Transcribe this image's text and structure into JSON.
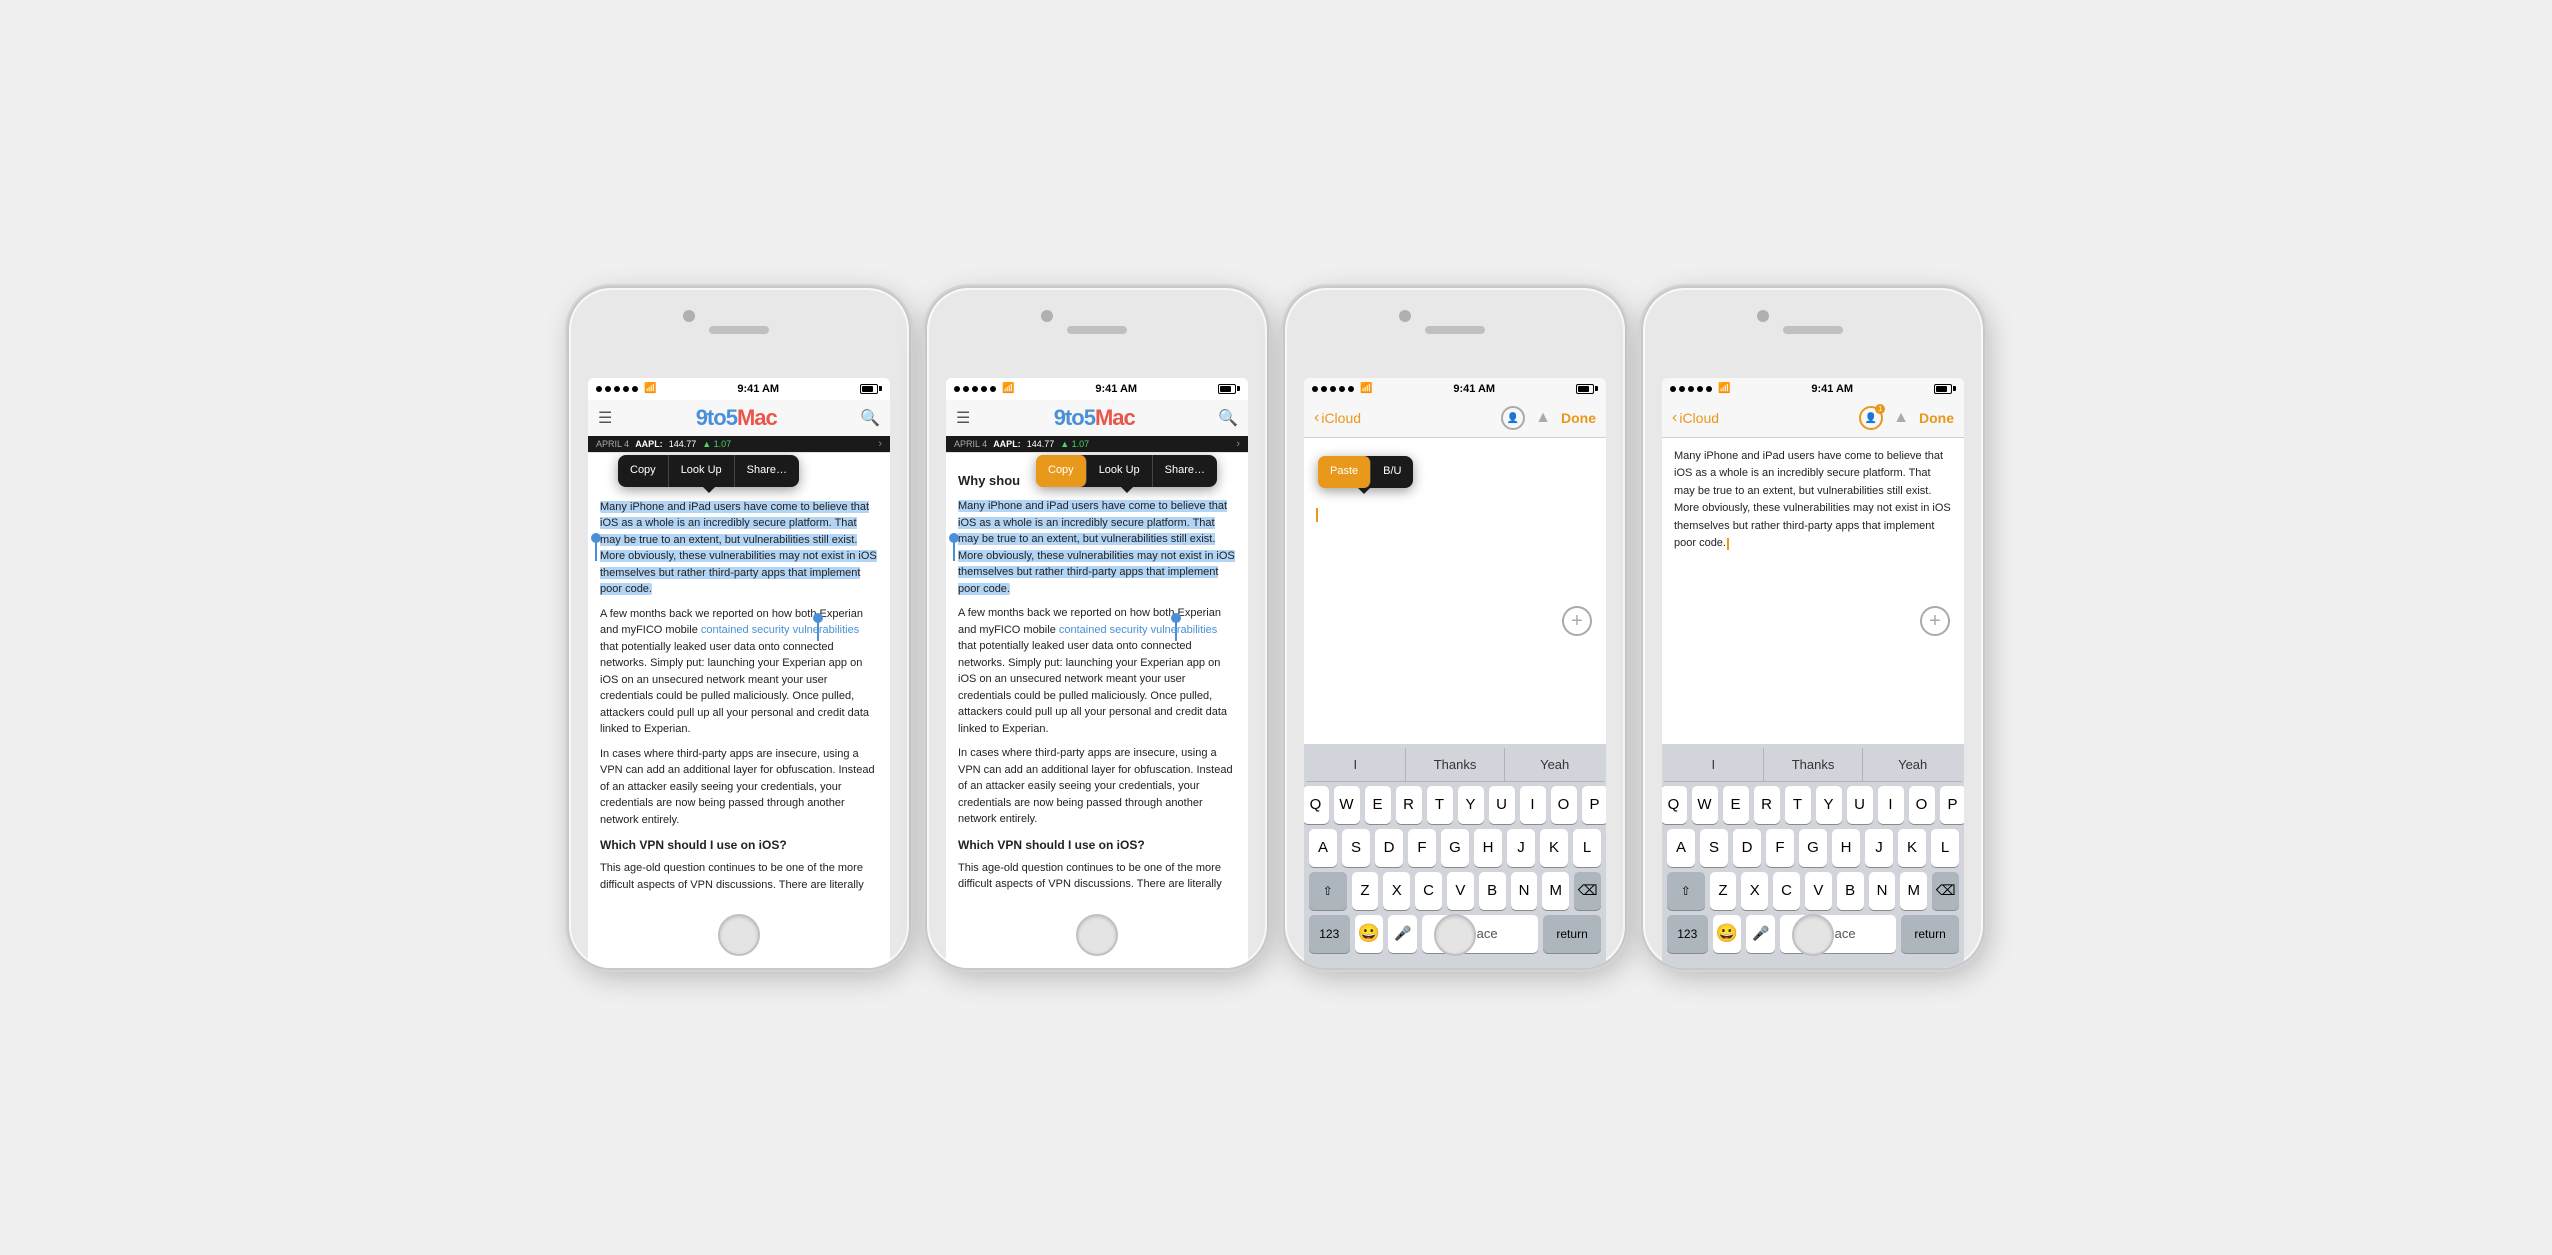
{
  "phones": [
    {
      "id": "phone1",
      "type": "safari",
      "status": {
        "dots": 5,
        "wifi": true,
        "time": "9:41 AM",
        "battery": "full"
      },
      "safari": {
        "url": "9to5mac.com",
        "logo": "9to5Mac",
        "ticker": {
          "date": "APRIL 4",
          "symbol": "AAPL:",
          "price": "144.77",
          "change": "1.07",
          "direction": "▲"
        }
      },
      "context_menu": {
        "buttons": [
          "Copy",
          "Look Up",
          "Share…"
        ],
        "highlighted": null,
        "position": "top"
      },
      "article": {
        "heading": null,
        "paragraphs": [
          "Many iPhone and iPad users have come to believe that iOS as a whole is an incredibly secure platform. That may be true to an extent, but vulnerabilities still exist. More obviously, these vulnerabilities may not exist in iOS themselves but rather third-party apps that implement poor code.",
          "A few months back we reported on how both Experian and myFICO mobile contained security vulnerabilities that potentially leaked user data onto connected networks. Simply put: launching your Experian app on iOS on an unsecured network meant your user credentials could be pulled maliciously. Once pulled, attackers could pull up all your personal and credit data linked to Experian.",
          "In cases where third-party apps are insecure, using a VPN can add an additional layer for obfuscation. Instead of an attacker easily seeing your credentials, your credentials are now being passed through another network entirely.",
          "Which VPN should I use on iOS?",
          "This age-old question continues to be one of the more difficult aspects of VPN discussions. There are literally"
        ],
        "link_text": "contained security vulnerabilities"
      },
      "selection": {
        "start_para": 0,
        "highlight": true
      }
    },
    {
      "id": "phone2",
      "type": "safari",
      "status": {
        "dots": 5,
        "wifi": true,
        "time": "9:41 AM",
        "battery": "full"
      },
      "safari": {
        "url": "9to5mac.com",
        "logo": "9to5Mac",
        "ticker": {
          "date": "APRIL 4",
          "symbol": "AAPL:",
          "price": "144.77",
          "change": "1.07",
          "direction": "▲"
        }
      },
      "context_menu": {
        "buttons": [
          "Copy",
          "Look Up",
          "Share…"
        ],
        "highlighted": "Copy",
        "position": "mid"
      },
      "article": {
        "heading": "Why shou",
        "paragraphs": [
          "Many iPhone and iPad users have come to believe that iOS as a whole is an incredibly secure platform. That may be true to an extent, but vulnerabilities still exist. More obviously, these vulnerabilities may not exist in iOS themselves but rather third-party apps that implement poor code.",
          "A few months back we reported on how both Experian and myFICO mobile contained security vulnerabilities that potentially leaked user data onto connected networks. Simply put: launching your Experian app on iOS on an unsecured network meant your user credentials could be pulled maliciously. Once pulled, attackers could pull up all your personal and credit data linked to Experian.",
          "In cases where third-party apps are insecure, using a VPN can add an additional layer for obfuscation. Instead of an attacker easily seeing your credentials, your credentials are now being passed through another network entirely.",
          "Which VPN should I use on iOS?",
          "This age-old question continues to be one of the more difficult aspects of VPN discussions. There are literally"
        ],
        "link_text": "contained security vulnerabilities"
      },
      "selection": {
        "highlight": true
      }
    },
    {
      "id": "phone3",
      "type": "notes",
      "status": {
        "dots": 5,
        "wifi": true,
        "time": "9:41 AM",
        "battery": "full"
      },
      "notes": {
        "back_label": "iCloud",
        "done_label": "Done",
        "person_icon": "👤",
        "share_icon": "⬆"
      },
      "context_menu": {
        "buttons": [
          "Paste",
          "B/U"
        ],
        "highlighted": "Paste"
      },
      "content": "",
      "keyboard": {
        "suggestions": [
          "I",
          "Thanks",
          "Yeah"
        ],
        "rows": [
          [
            "Q",
            "W",
            "E",
            "R",
            "T",
            "Y",
            "U",
            "I",
            "O",
            "P"
          ],
          [
            "A",
            "S",
            "D",
            "F",
            "G",
            "H",
            "J",
            "K",
            "L"
          ],
          [
            "shift",
            "Z",
            "X",
            "C",
            "V",
            "B",
            "N",
            "M",
            "delete"
          ],
          [
            "123",
            "emoji",
            "mic",
            "space",
            "return"
          ]
        ]
      }
    },
    {
      "id": "phone4",
      "type": "notes",
      "status": {
        "dots": 5,
        "wifi": true,
        "time": "9:41 AM",
        "battery": "full"
      },
      "notes": {
        "back_label": "iCloud",
        "done_label": "Done",
        "person_badge": "1"
      },
      "content": "Many iPhone and iPad users have come to believe that iOS as a whole is an incredibly secure platform. That may be true to an extent, but vulnerabilities still exist. More obviously, these vulnerabilities may not exist in iOS themselves but rather third-party apps that implement poor code.",
      "keyboard": {
        "suggestions": [
          "I",
          "Thanks",
          "Yeah"
        ],
        "rows": [
          [
            "Q",
            "W",
            "E",
            "R",
            "T",
            "Y",
            "U",
            "I",
            "O",
            "P"
          ],
          [
            "A",
            "S",
            "D",
            "F",
            "G",
            "H",
            "J",
            "K",
            "L"
          ],
          [
            "shift",
            "Z",
            "X",
            "C",
            "V",
            "B",
            "N",
            "M",
            "delete"
          ],
          [
            "123",
            "emoji",
            "mic",
            "space",
            "return"
          ]
        ]
      }
    }
  ],
  "labels": {
    "copy": "Copy",
    "look_up": "Look Up",
    "share": "Share…",
    "paste": "Paste",
    "bold_italic": "B/U",
    "done": "Done",
    "icloud": "iCloud",
    "space": "space",
    "return": "return",
    "numbers": "123"
  }
}
